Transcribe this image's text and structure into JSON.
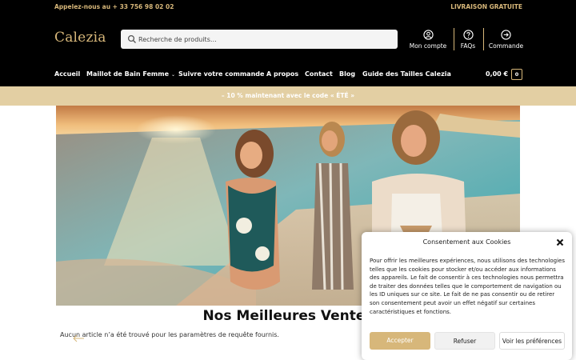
{
  "topbar": {
    "phone": "Appelez-nous au + 33 756 98 02 02",
    "shipping": "LIVRAISON GRATUITE"
  },
  "header": {
    "logo": "Calezia",
    "search_placeholder": "Recherche de produits…",
    "account_label": "Mon compte",
    "faq_label": "FAQs",
    "order_label": "Commande"
  },
  "nav": {
    "items": [
      "Accueil",
      "Maillot de Bain Femme",
      "Suivre votre commande",
      "A propos",
      "Contact",
      "Blog",
      "Guide des Tailles Calezia"
    ],
    "cart_total": "0,00 €",
    "cart_count": "0"
  },
  "promo": {
    "text": "– 10 % maintenant avec le code « ÉTÉ »"
  },
  "main": {
    "section_title": "Nos Meilleures Ventes",
    "empty_message": "Aucun article n’a été trouvé pour les paramètres de requête fournis."
  },
  "cookie": {
    "title": "Consentement aux Cookies",
    "body": "Pour offrir les meilleures expériences, nous utilisons des technologies telles que les cookies pour stocker et/ou accéder aux informations des appareils. Le fait de consentir à ces technologies nous permettra de traiter des données telles que le comportement de navigation ou les ID uniques sur ce site. Le fait de ne pas consentir ou de retirer son consentement peut avoir un effet négatif sur certaines caractéristiques et fonctions.",
    "accept": "Accepter",
    "refuse": "Refuser",
    "preferences": "Voir les préférences"
  },
  "colors": {
    "brand_gold": "#d7b77a",
    "header_bg": "#000000",
    "promo_bg": "#e3cfa3"
  },
  "icons": [
    "search-icon",
    "user-icon",
    "question-icon",
    "arrow-right-circle-icon",
    "close-icon",
    "arrow-left-icon"
  ]
}
